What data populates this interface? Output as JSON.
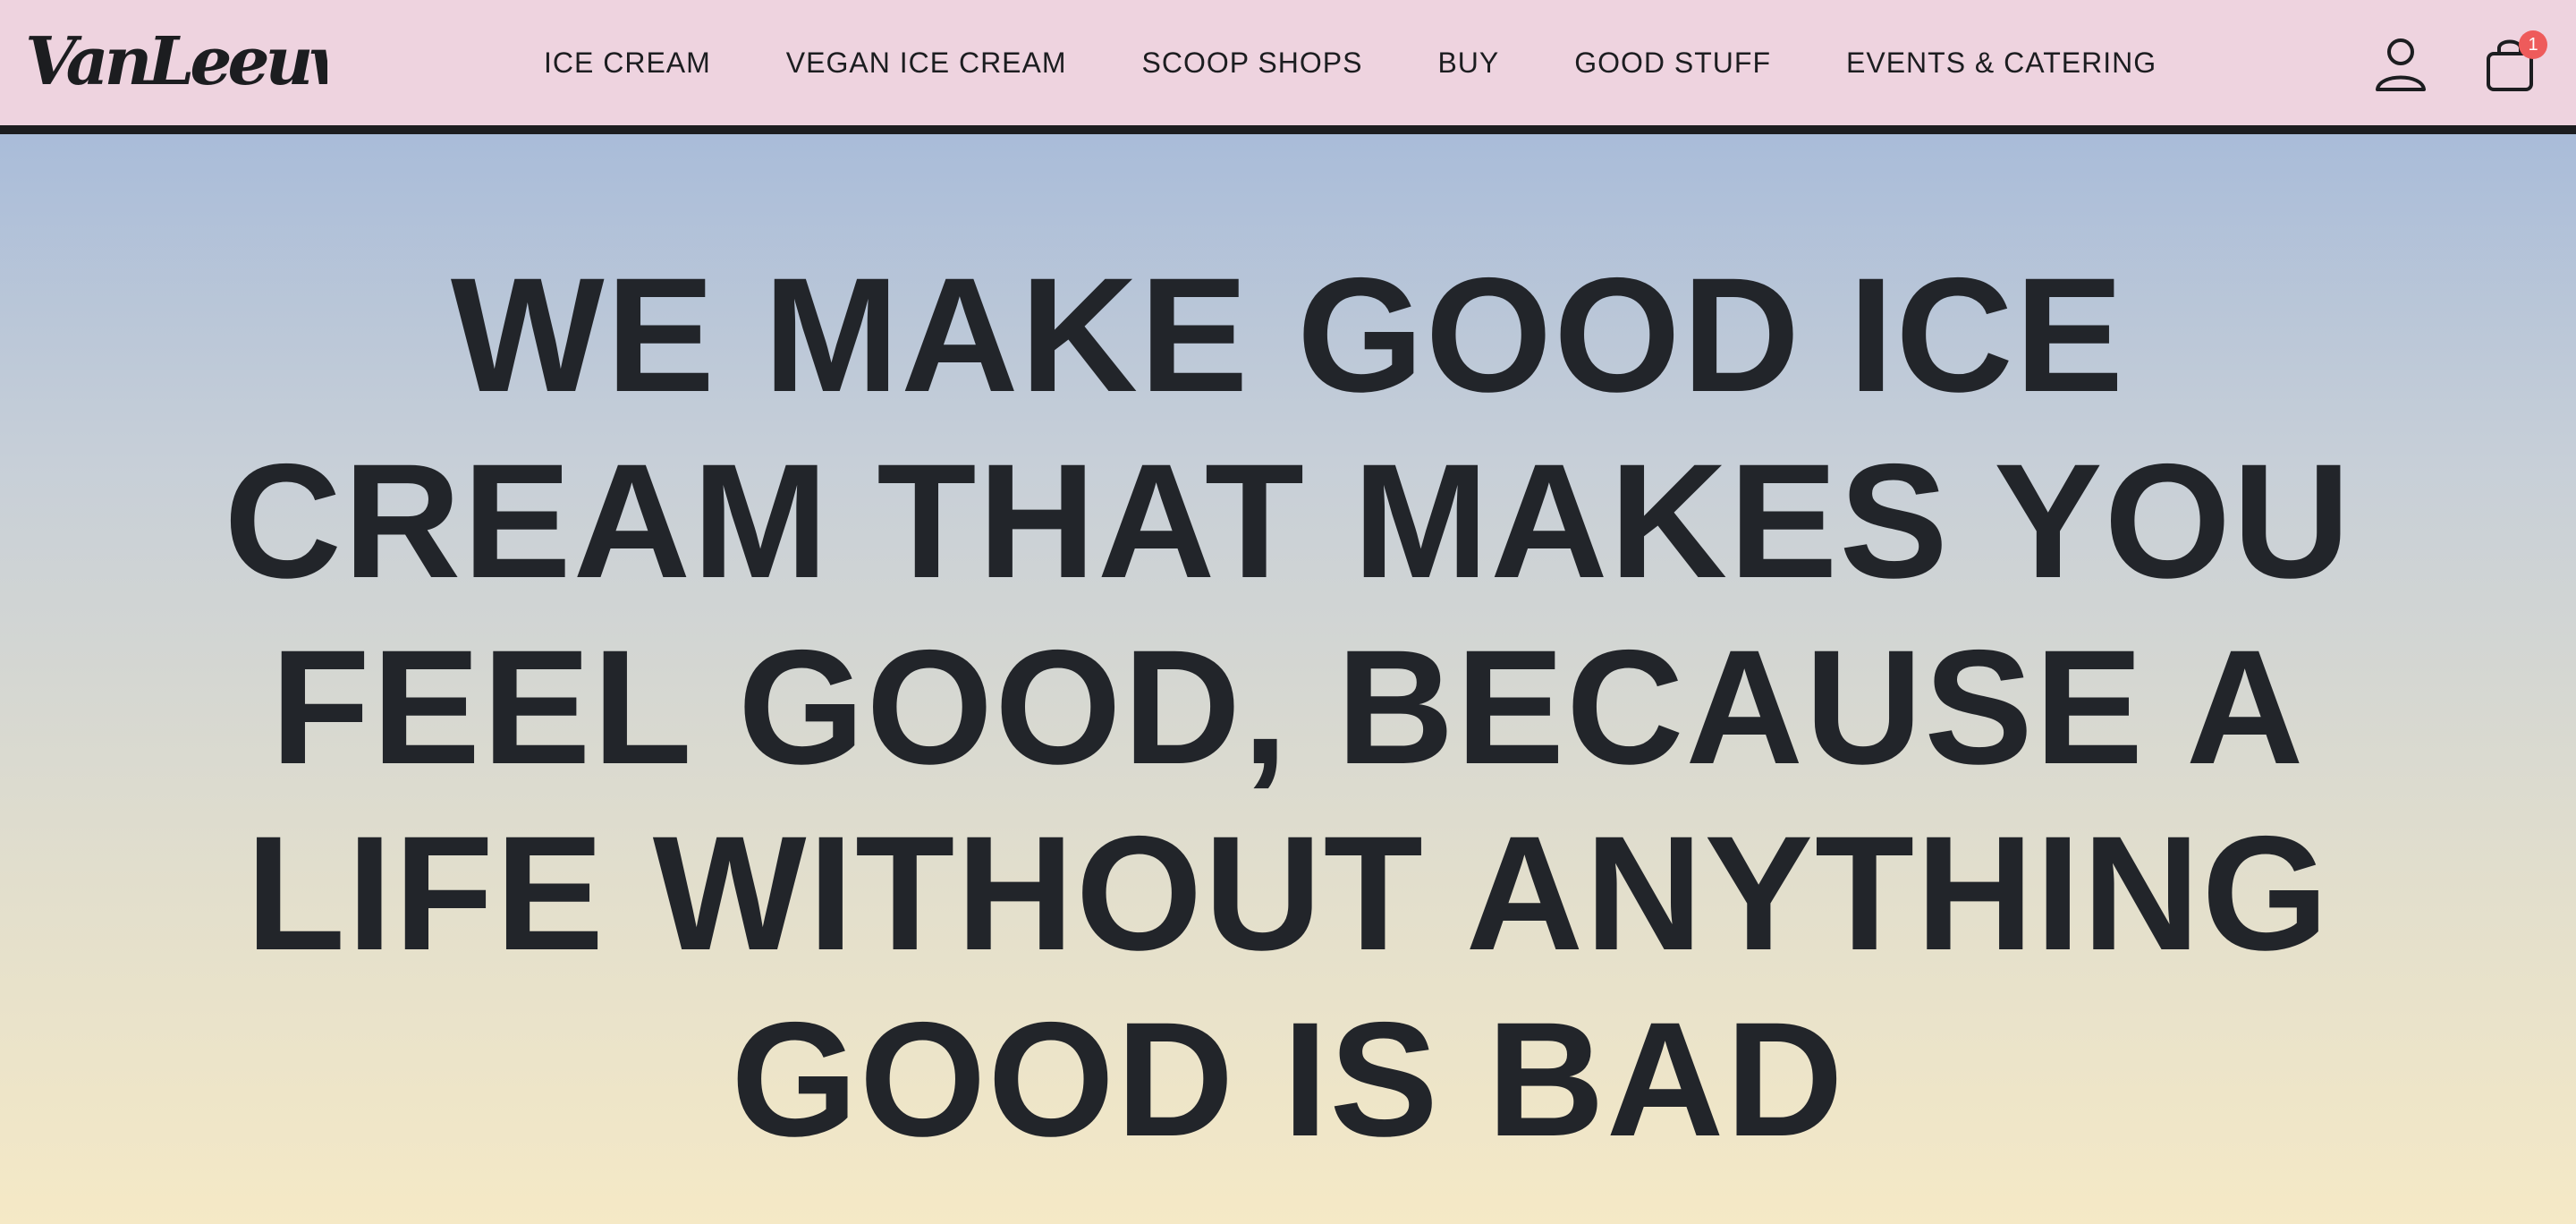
{
  "brand": {
    "logo_text": "VanLeeuwen"
  },
  "nav": {
    "items": [
      {
        "label": "ICE CREAM"
      },
      {
        "label": "VEGAN ICE CREAM"
      },
      {
        "label": "SCOOP SHOPS"
      },
      {
        "label": "BUY"
      },
      {
        "label": "GOOD STUFF"
      },
      {
        "label": "EVENTS & CATERING"
      }
    ]
  },
  "header_icons": {
    "account": "user-icon",
    "cart": "shopping-bag-icon",
    "cart_count": "1"
  },
  "hero": {
    "headline": "WE MAKE GOOD ICE CREAM THAT MAKES YOU FEEL GOOD, BECAUSE A LIFE WITHOUT ANYTHING GOOD IS BAD"
  },
  "colors": {
    "header_bg": "#eed3df",
    "header_border": "#1c1d20",
    "text": "#22252a",
    "gradient_top": "#a9bcd9",
    "gradient_bottom": "#f5e9c6",
    "badge": "#ee5b5b"
  }
}
